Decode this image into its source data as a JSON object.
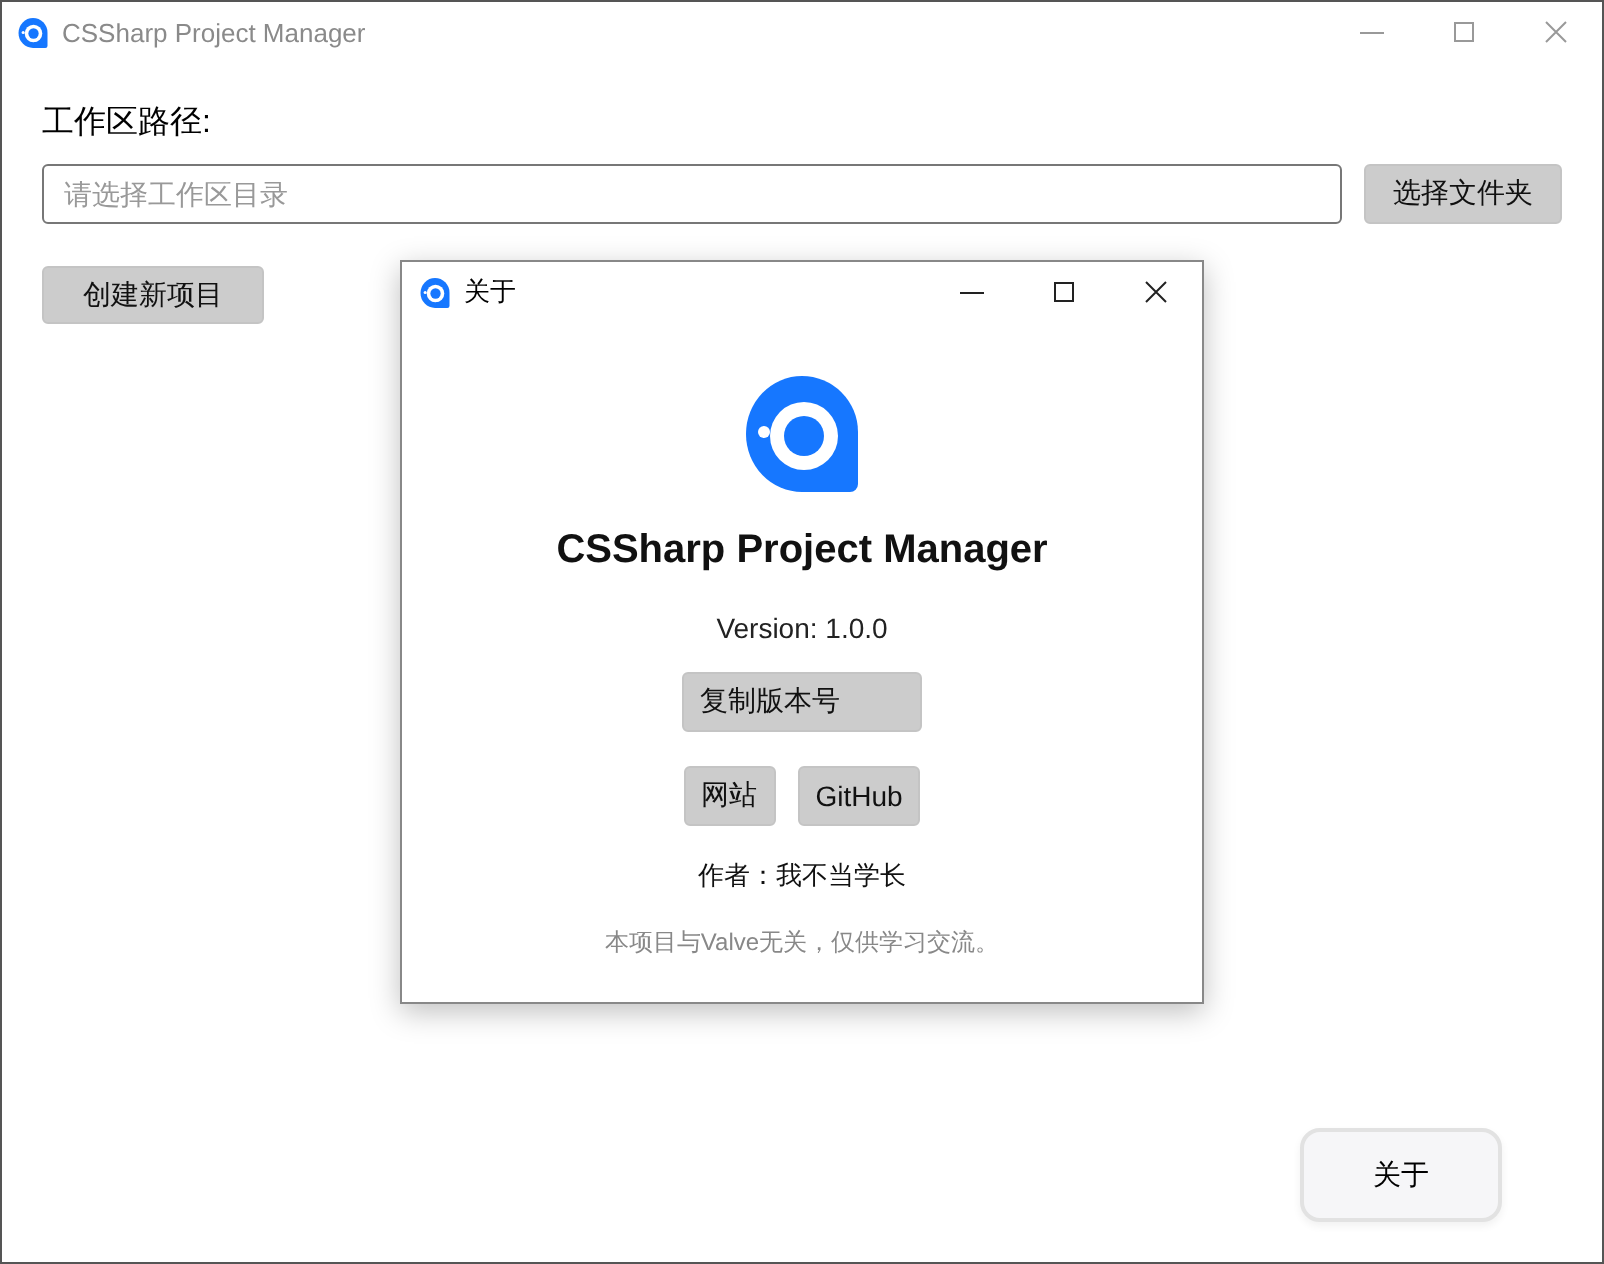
{
  "window": {
    "title": "CSSharp Project Manager",
    "active": false
  },
  "workspace": {
    "label": "工作区路径:",
    "placeholder": "请选择工作区目录",
    "browse_button": "选择文件夹"
  },
  "create_button": "创建新项目",
  "about_button": "关于",
  "about_dialog": {
    "title": "关于",
    "app_name": "CSSharp Project Manager",
    "version": "Version: 1.0.0",
    "copy_button": "复制版本号",
    "links": [
      "网站",
      "GitHub"
    ],
    "author": "作者：我不当学长",
    "disclaimer": "本项目与Valve无关，仅供学习交流。"
  }
}
